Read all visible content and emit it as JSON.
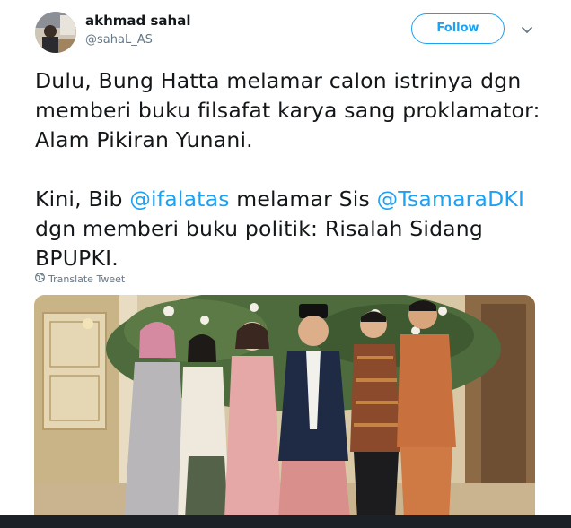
{
  "tweet": {
    "author": {
      "display_name": "akhmad sahal",
      "handle": "@sahaL_AS"
    },
    "follow_label": "Follow",
    "caret_icon": "chevron-down-icon",
    "text": {
      "para1": "Dulu, Bung Hatta melamar calon istrinya dgn memberi buku filsafat karya sang proklamator: Alam Pikiran Yunani.",
      "para2_before": "Kini, Bib ",
      "mention1": "@ifalatas",
      "para2_middle": " melamar Sis ",
      "mention2": "@TsamaraDKI",
      "para2_after": " dgn memberi buku politik: Risalah Sidang BPUPKI."
    },
    "translate_label": "Translate Tweet",
    "translate_icon": "globe-icon"
  },
  "colors": {
    "accent": "#1da1f2",
    "text": "#14171a",
    "secondary_text": "#657786"
  }
}
